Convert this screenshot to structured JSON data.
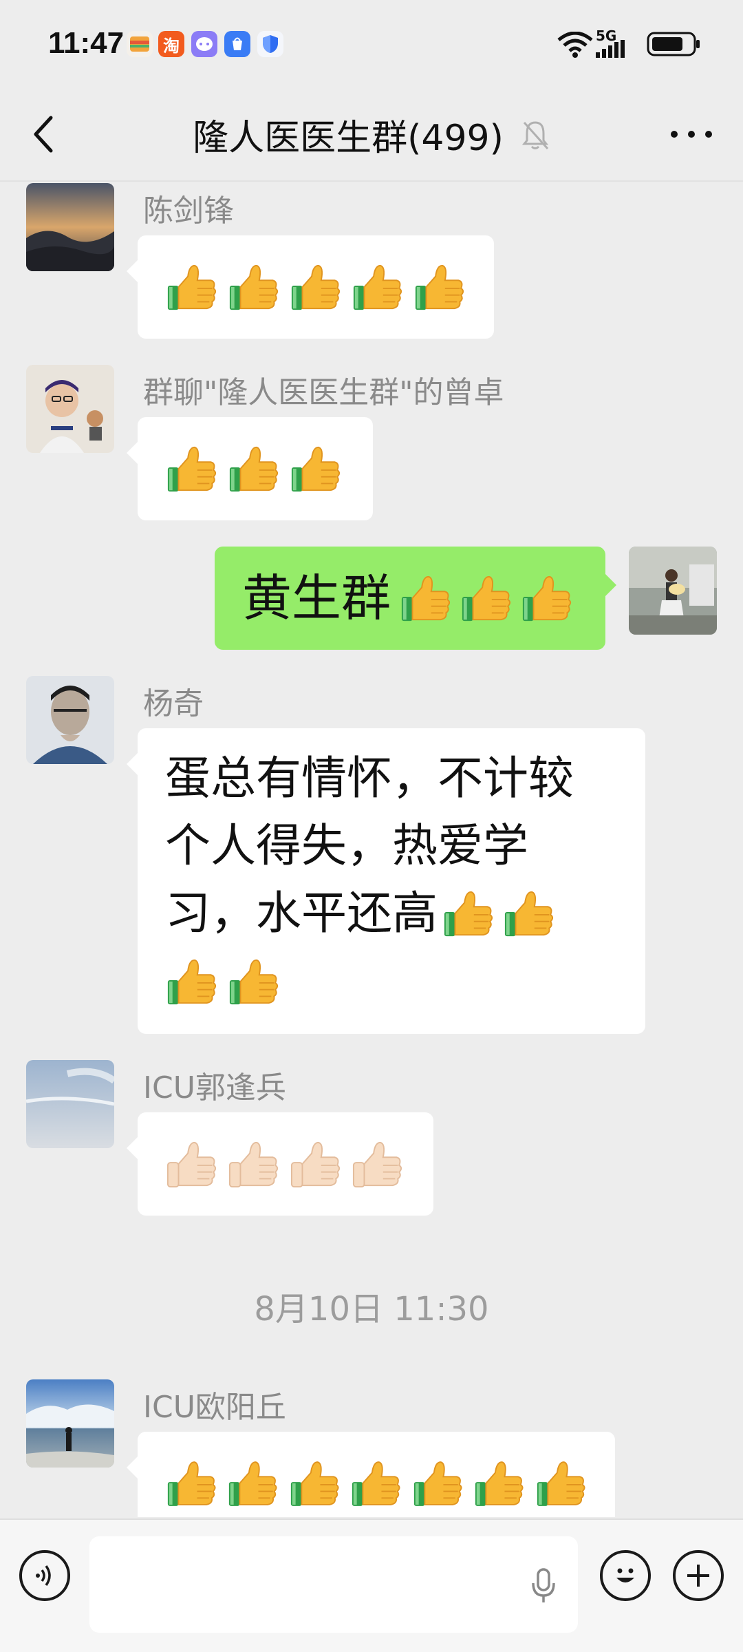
{
  "status_bar": {
    "time": "11:47",
    "apps": [
      {
        "name": "wallet-app-icon",
        "color": "#f2a33a",
        "glyph": ""
      },
      {
        "name": "taobao-app-icon",
        "color": "#f25b1e",
        "glyph": "淘"
      },
      {
        "name": "chat-app-icon",
        "color": "#7e6cf2",
        "glyph": ""
      },
      {
        "name": "app-market-icon",
        "color": "#3a7cf5",
        "glyph": ""
      },
      {
        "name": "shield-app-icon",
        "color": "#2f6df2",
        "glyph": ""
      }
    ],
    "network": "5G"
  },
  "header": {
    "title": "隆人医医生群(499)"
  },
  "messages": [
    {
      "sender": "陈剑锋",
      "text": "",
      "emoji_count": 5
    },
    {
      "sender": "群聊\"隆人医医生群\"的曾卓",
      "text": "",
      "emoji_count": 3
    },
    {
      "sender": "",
      "text": "黄生群",
      "emoji_count": 3
    },
    {
      "sender": "杨奇",
      "lines": [
        "蛋总有情怀，不计较",
        "个人得失，热爱学",
        "习，水平还高"
      ],
      "emoji_count": 4
    },
    {
      "sender": "ICU郭逢兵",
      "text": "",
      "emoji_count": 4,
      "skin": "light"
    },
    {
      "sender": "ICU欧阳丘",
      "text": "",
      "emoji_count": 7
    }
  ],
  "timestamp": "8月10日 11:30",
  "colors": {
    "background": "#ededed",
    "bubble_self": "#95ec69",
    "bubble_other": "#ffffff"
  }
}
